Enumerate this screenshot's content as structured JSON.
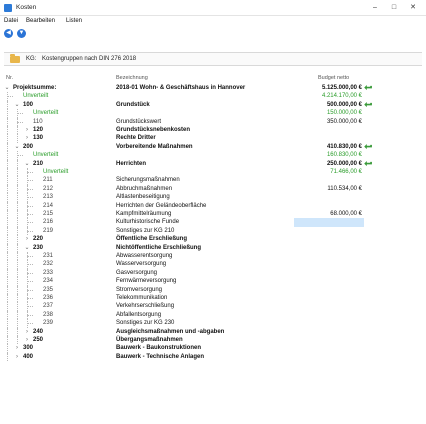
{
  "window": {
    "title": "Kosten"
  },
  "menu": [
    "Datei",
    "Bearbeiten",
    "Listen"
  ],
  "kg_bar": {
    "label": "KG:",
    "value": "Kostengruppen nach DIN 276 2018"
  },
  "columns": {
    "nr": "Nr.",
    "desc": "Bezeichnung",
    "amount": "Budget netto"
  },
  "colors": {
    "green": "#2a9d2a",
    "arrow": "#3a9a3a",
    "selection": "#cfe6fb",
    "accent": "#2b74d6"
  },
  "rows": [
    {
      "level": 0,
      "toggle": "v",
      "nr": "Projektsumme:",
      "desc": "2018-01 Wohn- & Geschäftshaus in Hannover",
      "amount": "5.125.000,00 €",
      "bold": true,
      "arrow": true
    },
    {
      "level": 1,
      "toggle": "",
      "nr": "Unverteilt",
      "desc": "",
      "amount": "4.214.170,00 €",
      "green": true
    },
    {
      "level": 1,
      "toggle": "v",
      "nr": "100",
      "desc": "Grundstück",
      "amount": "500.000,00 €",
      "bold": true,
      "arrow": true
    },
    {
      "level": 2,
      "toggle": "",
      "nr": "Unverteilt",
      "desc": "",
      "amount": "150.000,00 €",
      "green": true
    },
    {
      "level": 2,
      "toggle": "",
      "nr": "110",
      "desc": "Grundstückswert",
      "amount": "350.000,00 €"
    },
    {
      "level": 2,
      "toggle": ">",
      "nr": "120",
      "desc": "Grundstücksnebenkosten",
      "amount": "",
      "bold": true
    },
    {
      "level": 2,
      "toggle": ">",
      "nr": "130",
      "desc": "Rechte Dritter",
      "amount": "",
      "bold": true
    },
    {
      "level": 1,
      "toggle": "v",
      "nr": "200",
      "desc": "Vorbereitende Maßnahmen",
      "amount": "410.830,00 €",
      "bold": true,
      "arrow": true
    },
    {
      "level": 2,
      "toggle": "",
      "nr": "Unverteilt",
      "desc": "",
      "amount": "160.830,00 €",
      "green": true
    },
    {
      "level": 2,
      "toggle": "v",
      "nr": "210",
      "desc": "Herrichten",
      "amount": "250.000,00 €",
      "bold": true,
      "arrow": true
    },
    {
      "level": 3,
      "toggle": "",
      "nr": "Unverteilt",
      "desc": "",
      "amount": "71.466,00 €",
      "green": true
    },
    {
      "level": 3,
      "toggle": "",
      "nr": "211",
      "desc": "Sicherungsmaßnahmen",
      "amount": ""
    },
    {
      "level": 3,
      "toggle": "",
      "nr": "212",
      "desc": "Abbruchmaßnahmen",
      "amount": "110.534,00 €"
    },
    {
      "level": 3,
      "toggle": "",
      "nr": "213",
      "desc": "Altlastenbeseitigung",
      "amount": ""
    },
    {
      "level": 3,
      "toggle": "",
      "nr": "214",
      "desc": "Herrichten der Geländeoberfläche",
      "amount": ""
    },
    {
      "level": 3,
      "toggle": "",
      "nr": "215",
      "desc": "Kampfmittelräumung",
      "amount": "68.000,00 €"
    },
    {
      "level": 3,
      "toggle": "",
      "nr": "216",
      "desc": "Kulturhistorische Funde",
      "amount": "",
      "selected": true
    },
    {
      "level": 3,
      "toggle": "",
      "nr": "219",
      "desc": "Sonstiges zur KG 210",
      "amount": ""
    },
    {
      "level": 2,
      "toggle": ">",
      "nr": "220",
      "desc": "Öffentliche Erschließung",
      "amount": "",
      "bold": true
    },
    {
      "level": 2,
      "toggle": "v",
      "nr": "230",
      "desc": "Nichtöffentliche Erschließung",
      "amount": "",
      "bold": true
    },
    {
      "level": 3,
      "toggle": "",
      "nr": "231",
      "desc": "Abwasserentsorgung",
      "amount": ""
    },
    {
      "level": 3,
      "toggle": "",
      "nr": "232",
      "desc": "Wasserversorgung",
      "amount": ""
    },
    {
      "level": 3,
      "toggle": "",
      "nr": "233",
      "desc": "Gasversorgung",
      "amount": ""
    },
    {
      "level": 3,
      "toggle": "",
      "nr": "234",
      "desc": "Fernwärmeversorgung",
      "amount": ""
    },
    {
      "level": 3,
      "toggle": "",
      "nr": "235",
      "desc": "Stromversorgung",
      "amount": ""
    },
    {
      "level": 3,
      "toggle": "",
      "nr": "236",
      "desc": "Telekommunikation",
      "amount": ""
    },
    {
      "level": 3,
      "toggle": "",
      "nr": "237",
      "desc": "Verkehrserschließung",
      "amount": ""
    },
    {
      "level": 3,
      "toggle": "",
      "nr": "238",
      "desc": "Abfallentsorgung",
      "amount": ""
    },
    {
      "level": 3,
      "toggle": "",
      "nr": "239",
      "desc": "Sonstiges zur KG 230",
      "amount": ""
    },
    {
      "level": 2,
      "toggle": ">",
      "nr": "240",
      "desc": "Ausgleichsmaßnahmen und -abgaben",
      "amount": "",
      "bold": true
    },
    {
      "level": 2,
      "toggle": ">",
      "nr": "250",
      "desc": "Übergangsmaßnahmen",
      "amount": "",
      "bold": true
    },
    {
      "level": 1,
      "toggle": ">",
      "nr": "300",
      "desc": "Bauwerk - Baukonstruktionen",
      "amount": "",
      "bold": true
    },
    {
      "level": 1,
      "toggle": ">",
      "nr": "400",
      "desc": "Bauwerk - Technische Anlagen",
      "amount": "",
      "bold": true
    }
  ]
}
